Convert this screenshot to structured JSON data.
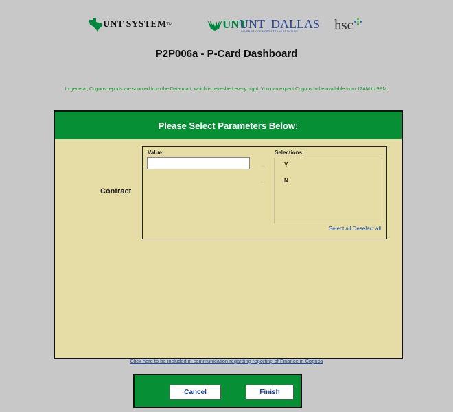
{
  "logos": {
    "unt_system": "UNT SYSTEM",
    "unt_system_tm": "TM",
    "unt": "UNT",
    "unt_dallas_left": "UNT",
    "unt_dallas_right": "DALLAS",
    "unt_dallas_sub": "UNIVERSITY OF NORTH TEXAS AT DALLAS",
    "hsc": "hsc"
  },
  "page": {
    "title": "P2P006a - P-Card Dashboard",
    "notice": "In general, Cognos reports are sourced from the Data mart, which is refreshed every night. You can expect Cognos to be available from 12AM to 9PM."
  },
  "panel": {
    "header": "Please Select Parameters Below:",
    "prompt_label": "Contract",
    "value_label": "Value:",
    "value_input": "",
    "selections_label": "Selections:",
    "arrow_add": "→",
    "arrow_remove": "←",
    "selections": [
      "Y",
      "N"
    ],
    "select_all": "Select all",
    "deselect_all": "Deselect all"
  },
  "footer": {
    "link": "Click here to be included in communication regarding reporting of Finance in Cognos"
  },
  "buttons": {
    "cancel": "Cancel",
    "finish": "Finish"
  },
  "colors": {
    "brand_green": "#078f36",
    "panel_bg": "#e6dca6",
    "link_blue": "#1d4ea3",
    "page_bg": "#c8c8c8"
  }
}
